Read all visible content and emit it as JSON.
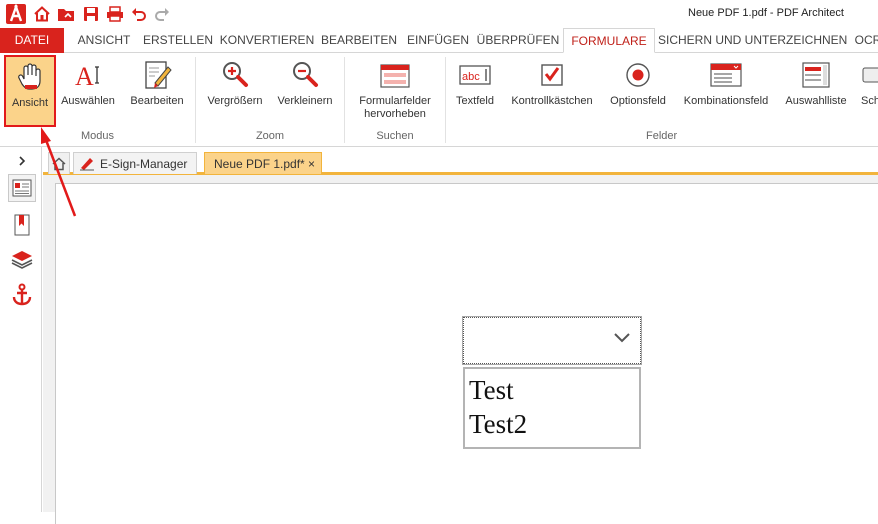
{
  "window": {
    "title": "Neue PDF 1.pdf   -   PDF Architect"
  },
  "quick_access": [
    "app-logo-icon",
    "home-icon",
    "open-folder-icon",
    "save-icon",
    "print-icon",
    "undo-icon",
    "redo-icon"
  ],
  "ribbon_tabs": [
    {
      "label": "DATEI"
    },
    {
      "label": "ANSICHT"
    },
    {
      "label": "ERSTELLEN"
    },
    {
      "label": "KONVERTIEREN"
    },
    {
      "label": "BEARBEITEN"
    },
    {
      "label": "EINFÜGEN"
    },
    {
      "label": "ÜBERPRÜFEN"
    },
    {
      "label": "FORMULARE"
    },
    {
      "label": "SICHERN UND UNTERZEICHNEN"
    },
    {
      "label": "OCR"
    }
  ],
  "active_tab": "FORMULARE",
  "ribbon": {
    "groups": [
      {
        "label": "Modus",
        "buttons": [
          {
            "label": "Ansicht",
            "icon": "hand-icon",
            "selected": true
          },
          {
            "label": "Auswählen",
            "icon": "text-cursor-icon"
          },
          {
            "label": "Bearbeiten",
            "icon": "edit-form-icon"
          }
        ]
      },
      {
        "label": "Zoom",
        "buttons": [
          {
            "label": "Vergrößern",
            "icon": "zoom-in-icon"
          },
          {
            "label": "Verkleinern",
            "icon": "zoom-out-icon"
          }
        ]
      },
      {
        "label": "Suchen",
        "buttons": [
          {
            "label": "Formularfelder hervorheben",
            "icon": "highlight-fields-icon"
          }
        ]
      },
      {
        "label": "Felder",
        "buttons": [
          {
            "label": "Textfeld",
            "icon": "textfield-icon"
          },
          {
            "label": "Kontrollkästchen",
            "icon": "checkbox-icon"
          },
          {
            "label": "Optionsfeld",
            "icon": "radio-icon"
          },
          {
            "label": "Kombinationsfeld",
            "icon": "combobox-icon"
          },
          {
            "label": "Auswahlliste",
            "icon": "listbox-icon"
          },
          {
            "label": "Sch",
            "icon": "button-icon"
          }
        ]
      }
    ]
  },
  "doc_tabs": [
    {
      "label": "E-Sign-Manager"
    },
    {
      "label": "Neue PDF 1.pdf*",
      "close": "×"
    }
  ],
  "document": {
    "combo_box": {
      "value": ""
    },
    "list_box": {
      "items": [
        "Test",
        "Test2"
      ]
    }
  },
  "colors": {
    "accent": "#d9231d",
    "selected_fill": "#fbd38a",
    "tab_underline": "#f2b43c"
  }
}
